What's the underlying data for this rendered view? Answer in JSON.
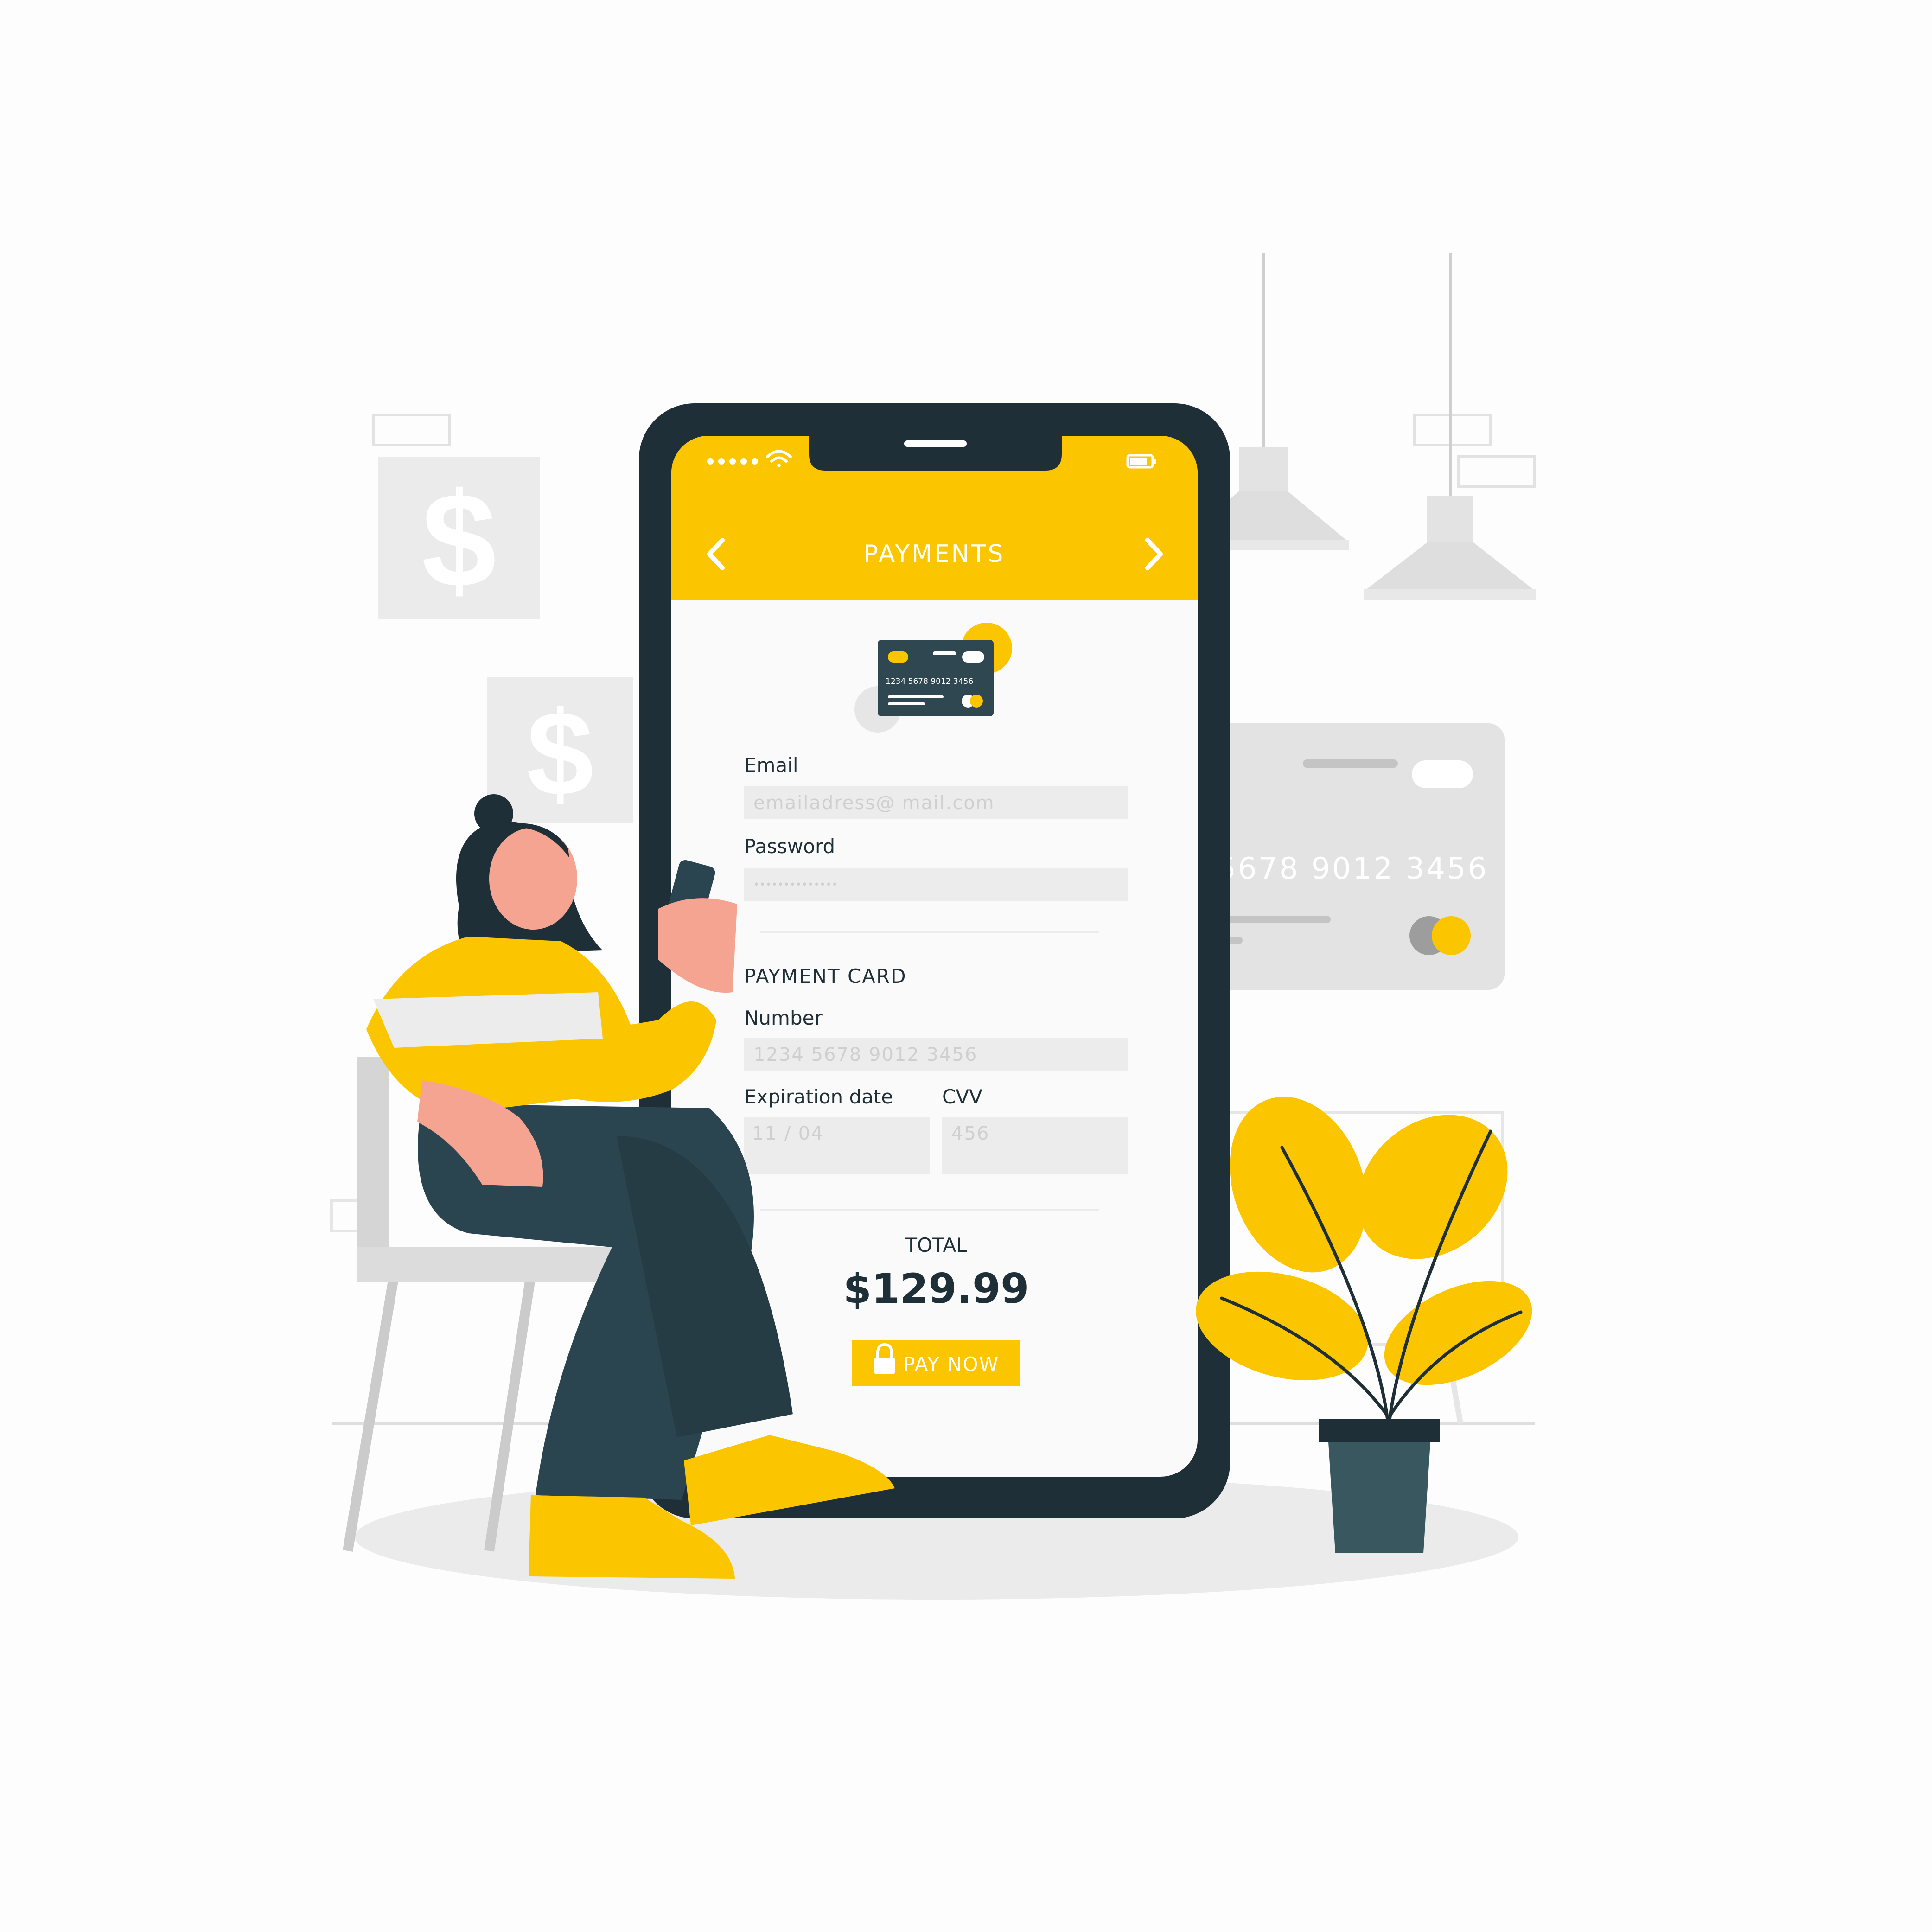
{
  "status_bar": {
    "wifi_icon": "wifi-icon",
    "battery_icon": "battery-icon"
  },
  "header": {
    "title": "PAYMENTS",
    "back_icon": "chevron-left-icon",
    "forward_icon": "chevron-right-icon"
  },
  "card_icon": {
    "number": "1234  5678  9012  3456"
  },
  "form": {
    "email": {
      "label": "Email",
      "placeholder": "emailadress@ mail.com"
    },
    "password": {
      "label": "Password",
      "placeholder": "••••••••••••••"
    },
    "section_title": "PAYMENT CARD",
    "number": {
      "label": "Number",
      "placeholder": "1234 5678 9012 3456"
    },
    "expiration": {
      "label": "Expiration date",
      "placeholder": "11 / 04"
    },
    "cvv": {
      "label": "CVV",
      "placeholder": "456"
    }
  },
  "total": {
    "label": "TOTAL",
    "amount": "$129.99"
  },
  "pay_button": {
    "label": "PAY NOW",
    "icon": "lock-icon"
  },
  "background": {
    "dollar_sign": "$",
    "big_card_number": "5678  9012  3456"
  },
  "colors": {
    "accent": "#fbc500",
    "dark": "#1f2f37",
    "screen": "#fafafa",
    "field": "#ececec"
  }
}
